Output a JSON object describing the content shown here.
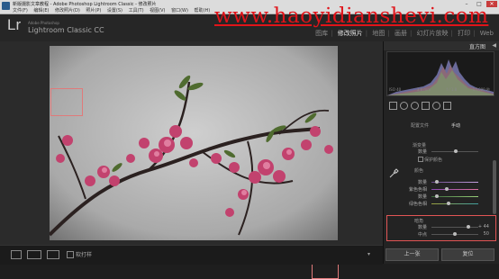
{
  "window": {
    "title": "新版摄影文章教程 - Adobe Photoshop Lightroom Classic - 修改照片",
    "menus": [
      "文件(F)",
      "编辑(E)",
      "修改照片(D)",
      "照片(P)",
      "设置(S)",
      "工具(T)",
      "视图(V)",
      "窗口(W)",
      "帮助(H)"
    ],
    "controls": [
      "–",
      "□",
      "✕"
    ]
  },
  "watermark": "www.haoyidianshevi.com",
  "header": {
    "logo": "Lr",
    "company": "Adobe Photoshop",
    "product": "Lightroom Classic CC",
    "modules": [
      "图库",
      "修改照片",
      "地图",
      "画册",
      "幻灯片放映",
      "打印",
      "Web"
    ],
    "active_module": "修改照片"
  },
  "toolbar": {
    "text": "软打样",
    "dropdown_icon": "▾"
  },
  "panel": {
    "histogram_label": "直方图",
    "arrow": "◀",
    "hist_info": [
      "ISO 40",
      "3.8 mm",
      "f / 1.8",
      "1/1000 秒"
    ],
    "tabs": [
      "配置文件",
      "手动"
    ],
    "sections": {
      "grad_label": "渐变量",
      "color_label": "颜色",
      "vignette_label": "暗角"
    },
    "rows": {
      "amount": {
        "label": "数量",
        "value": "0"
      },
      "protect": {
        "label": "保护颜色"
      },
      "red_hue": {
        "label": "紫色色相",
        "value": ""
      },
      "green_hue": {
        "label": "绿色色相",
        "value": ""
      },
      "vignette_amount": {
        "label": "数量",
        "value": "+ 44"
      },
      "vignette_mid": {
        "label": "中点",
        "value": "50"
      }
    },
    "buttons": {
      "prev": "上一张",
      "reset": "复位"
    }
  }
}
